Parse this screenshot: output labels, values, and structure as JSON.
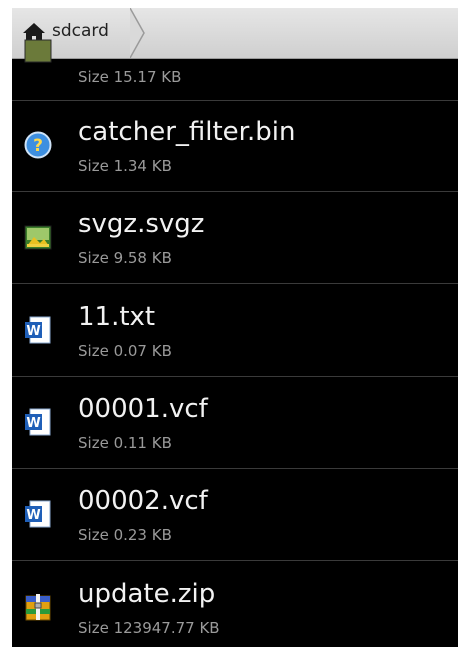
{
  "pathbar": {
    "crumb_label": "sdcard",
    "home_icon": "home-icon"
  },
  "files": [
    {
      "name": "",
      "size_label": "Size",
      "size": "15.17 KB",
      "icon": "image-icon"
    },
    {
      "name": "catcher_filter.bin",
      "size_label": "Size",
      "size": "1.34 KB",
      "icon": "unknown-file-icon"
    },
    {
      "name": "svgz.svgz",
      "size_label": "Size",
      "size": "9.58 KB",
      "icon": "image-icon"
    },
    {
      "name": "11.txt",
      "size_label": "Size",
      "size": "0.07 KB",
      "icon": "word-document-icon"
    },
    {
      "name": "00001.vcf",
      "size_label": "Size",
      "size": "0.11 KB",
      "icon": "word-document-icon"
    },
    {
      "name": "00002.vcf",
      "size_label": "Size",
      "size": "0.23 KB",
      "icon": "word-document-icon"
    },
    {
      "name": "update.zip",
      "size_label": "Size",
      "size": "123947.77 KB",
      "icon": "archive-icon"
    }
  ],
  "colors": {
    "background": "#000000",
    "text_primary": "#f2f2f2",
    "text_secondary": "#9a9a9a",
    "divider": "#3a3a3a"
  }
}
